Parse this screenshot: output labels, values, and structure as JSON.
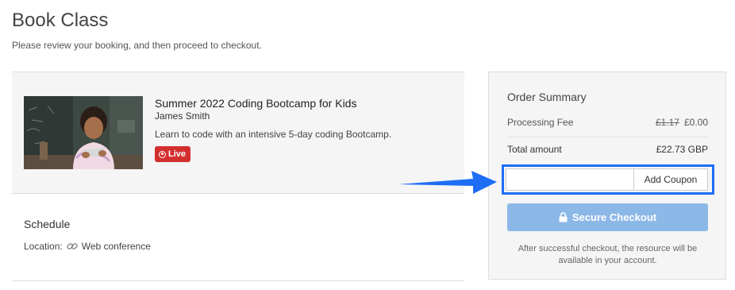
{
  "page": {
    "title": "Book Class",
    "subtitle": "Please review your booking, and then proceed to checkout."
  },
  "booking": {
    "class_title": "Summer 2022 Coding Bootcamp for Kids",
    "instructor": "James Smith",
    "description": "Learn to code with an intensive 5-day coding Bootcamp.",
    "live_label": "Live",
    "live_color": "#d32f2f"
  },
  "schedule": {
    "heading": "Schedule",
    "location_label": "Location:",
    "location_icon": "link-icon",
    "location_value": "Web conference"
  },
  "order_summary": {
    "title": "Order Summary",
    "processing_fee_label": "Processing Fee",
    "processing_fee_original": "£1.17",
    "processing_fee_value": "£0.00",
    "total_label": "Total amount",
    "total_value": "£22.73 GBP",
    "coupon_placeholder": "",
    "coupon_value": "",
    "coupon_button": "Add Coupon",
    "checkout_button": "Secure Checkout",
    "checkout_icon": "lock-icon",
    "checkout_note": "After successful checkout, the resource will be available in your account."
  },
  "annotation": {
    "highlight_color": "#1e6ef5",
    "arrow_color": "#1e6ef5"
  }
}
